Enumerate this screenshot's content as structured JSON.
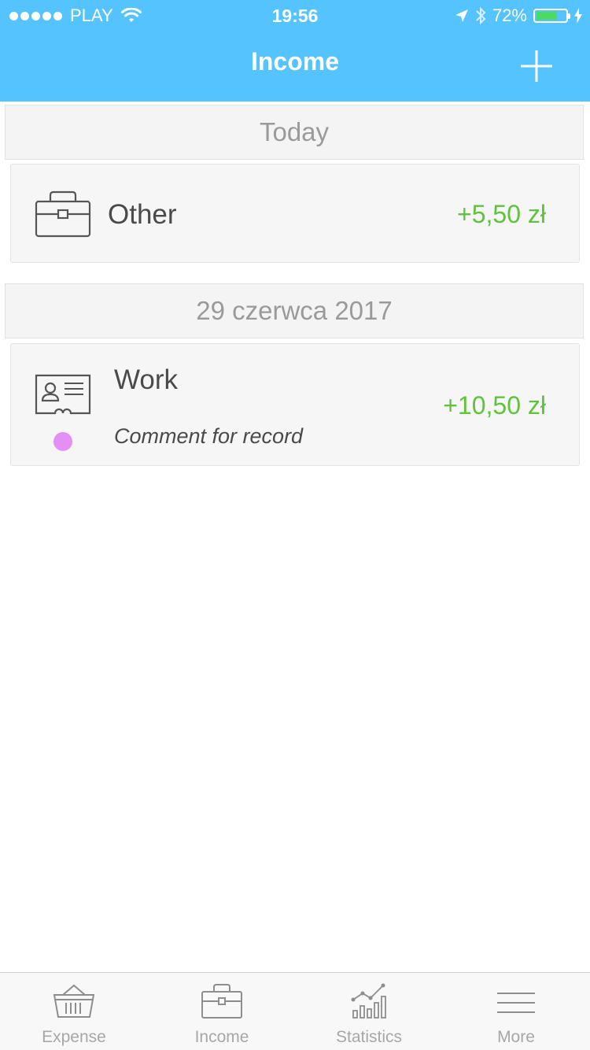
{
  "status_bar": {
    "carrier": "PLAY",
    "time": "19:56",
    "battery_percent": "72%",
    "battery_level": 0.72
  },
  "nav": {
    "title": "Income",
    "add_icon": "plus-icon"
  },
  "sections": [
    {
      "header": "Today",
      "records": [
        {
          "category": "Other",
          "amount": "+5,50 zł",
          "icon": "briefcase-icon"
        }
      ]
    },
    {
      "header": "29 czerwca 2017",
      "records": [
        {
          "category": "Work",
          "amount": "+10,50 zł",
          "comment": "Comment for record",
          "icon": "id-card-icon",
          "dot_color": "#e38ff3"
        }
      ]
    }
  ],
  "tabs": [
    {
      "label": "Expense",
      "icon": "basket-icon"
    },
    {
      "label": "Income",
      "icon": "briefcase-icon"
    },
    {
      "label": "Statistics",
      "icon": "chart-icon"
    },
    {
      "label": "More",
      "icon": "menu-icon"
    }
  ],
  "colors": {
    "header": "#55c3fd",
    "amount": "#5fc33c",
    "section_text": "#9a9a9a"
  }
}
